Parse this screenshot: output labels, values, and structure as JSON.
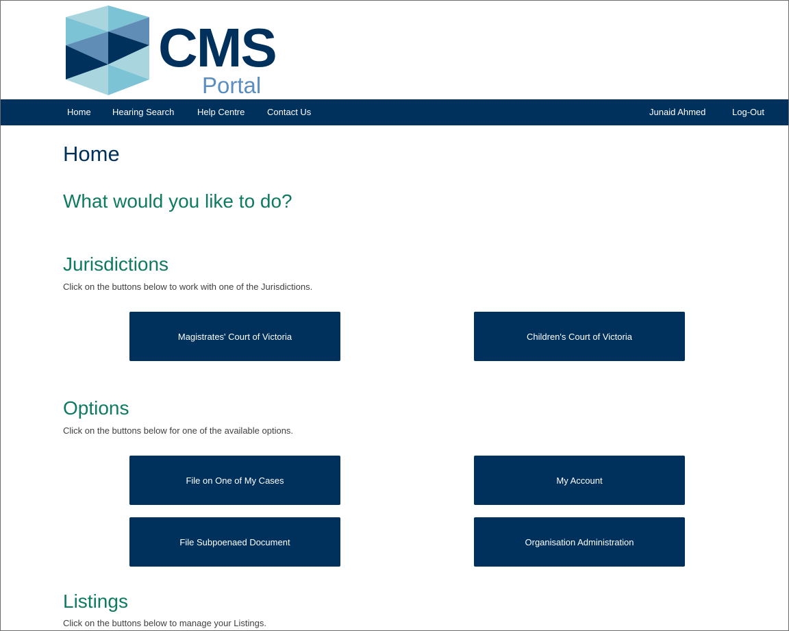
{
  "logo": {
    "title": "CMS",
    "subtitle": "Portal"
  },
  "nav": {
    "left_items": [
      "Home",
      "Hearing Search",
      "Help Centre",
      "Contact Us"
    ],
    "user_name": "Junaid Ahmed",
    "logout_label": "Log-Out"
  },
  "page": {
    "title": "Home",
    "prompt": "What would you like to do?"
  },
  "jurisdictions": {
    "heading": "Jurisdictions",
    "description": "Click on the buttons below to work with one of the Jurisdictions.",
    "buttons": [
      "Magistrates' Court of Victoria",
      "Children's Court of Victoria"
    ]
  },
  "options": {
    "heading": "Options",
    "description": "Click on the buttons below for one of the available options.",
    "buttons": [
      "File on One of My Cases",
      "My Account",
      "File Subpoenaed Document",
      "Organisation Administration"
    ]
  },
  "listings": {
    "heading": "Listings",
    "description": "Click on the buttons below to manage your Listings."
  },
  "colors": {
    "brand_navy": "#00305c",
    "heading_green": "#0e7a60",
    "portal_blue": "#5b8dc0"
  }
}
